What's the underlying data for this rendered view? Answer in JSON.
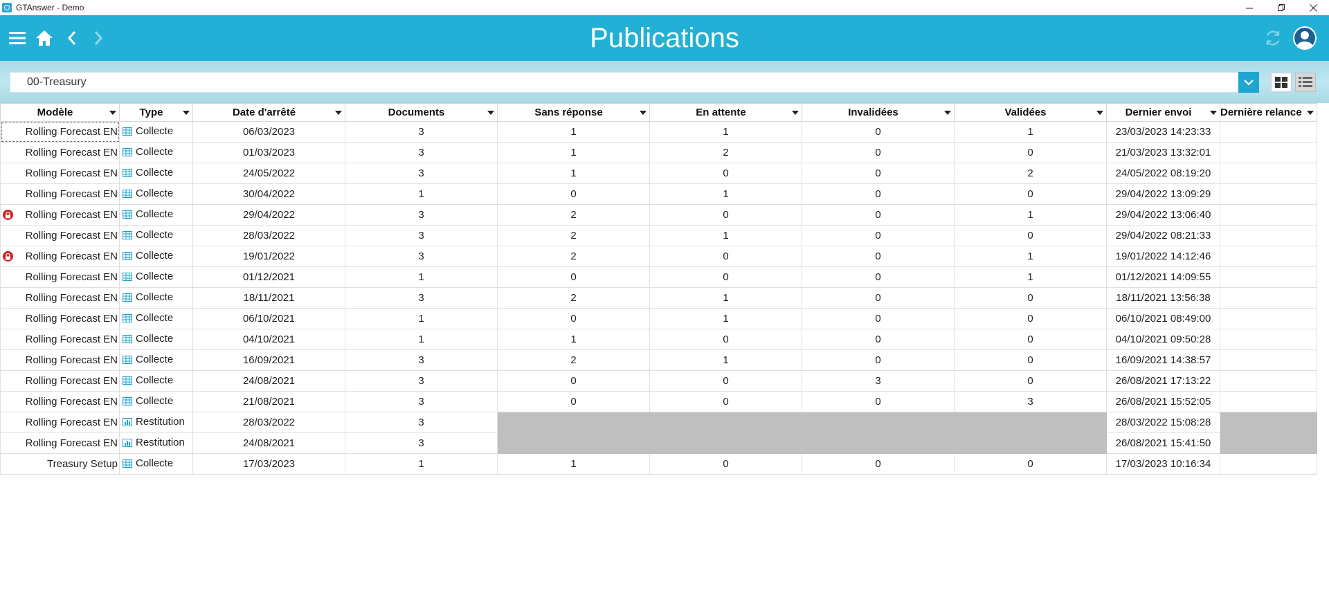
{
  "window": {
    "title": "GTAnswer - Demo"
  },
  "header": {
    "title": "Publications"
  },
  "filter": {
    "selected": "00-Treasury"
  },
  "table": {
    "columns": [
      "Modèle",
      "Type",
      "Date d'arrêté",
      "Documents",
      "Sans réponse",
      "En attente",
      "Invalidées",
      "Validées",
      "Dernier envoi",
      "Dernière relance"
    ],
    "rows": [
      {
        "modele": "Rolling Forecast EN",
        "locked": false,
        "type": "Collecte",
        "date": "06/03/2023",
        "documents": "3",
        "sans_reponse": "1",
        "en_attente": "1",
        "invalidees": "0",
        "validees": "1",
        "dernier_envoi": "23/03/2023 14:23:33",
        "derniere_relance": ""
      },
      {
        "modele": "Rolling Forecast EN",
        "locked": false,
        "type": "Collecte",
        "date": "01/03/2023",
        "documents": "3",
        "sans_reponse": "1",
        "en_attente": "2",
        "invalidees": "0",
        "validees": "0",
        "dernier_envoi": "21/03/2023 13:32:01",
        "derniere_relance": ""
      },
      {
        "modele": "Rolling Forecast EN",
        "locked": false,
        "type": "Collecte",
        "date": "24/05/2022",
        "documents": "3",
        "sans_reponse": "1",
        "en_attente": "0",
        "invalidees": "0",
        "validees": "2",
        "dernier_envoi": "24/05/2022 08:19:20",
        "derniere_relance": ""
      },
      {
        "modele": "Rolling Forecast EN",
        "locked": false,
        "type": "Collecte",
        "date": "30/04/2022",
        "documents": "1",
        "sans_reponse": "0",
        "en_attente": "1",
        "invalidees": "0",
        "validees": "0",
        "dernier_envoi": "29/04/2022 13:09:29",
        "derniere_relance": ""
      },
      {
        "modele": "Rolling Forecast EN",
        "locked": true,
        "type": "Collecte",
        "date": "29/04/2022",
        "documents": "3",
        "sans_reponse": "2",
        "en_attente": "0",
        "invalidees": "0",
        "validees": "1",
        "dernier_envoi": "29/04/2022 13:06:40",
        "derniere_relance": ""
      },
      {
        "modele": "Rolling Forecast EN",
        "locked": false,
        "type": "Collecte",
        "date": "28/03/2022",
        "documents": "3",
        "sans_reponse": "2",
        "en_attente": "1",
        "invalidees": "0",
        "validees": "0",
        "dernier_envoi": "29/04/2022 08:21:33",
        "derniere_relance": ""
      },
      {
        "modele": "Rolling Forecast EN",
        "locked": true,
        "type": "Collecte",
        "date": "19/01/2022",
        "documents": "3",
        "sans_reponse": "2",
        "en_attente": "0",
        "invalidees": "0",
        "validees": "1",
        "dernier_envoi": "19/01/2022 14:12:46",
        "derniere_relance": ""
      },
      {
        "modele": "Rolling Forecast EN",
        "locked": false,
        "type": "Collecte",
        "date": "01/12/2021",
        "documents": "1",
        "sans_reponse": "0",
        "en_attente": "0",
        "invalidees": "0",
        "validees": "1",
        "dernier_envoi": "01/12/2021 14:09:55",
        "derniere_relance": ""
      },
      {
        "modele": "Rolling Forecast EN",
        "locked": false,
        "type": "Collecte",
        "date": "18/11/2021",
        "documents": "3",
        "sans_reponse": "2",
        "en_attente": "1",
        "invalidees": "0",
        "validees": "0",
        "dernier_envoi": "18/11/2021 13:56:38",
        "derniere_relance": ""
      },
      {
        "modele": "Rolling Forecast EN",
        "locked": false,
        "type": "Collecte",
        "date": "06/10/2021",
        "documents": "1",
        "sans_reponse": "0",
        "en_attente": "1",
        "invalidees": "0",
        "validees": "0",
        "dernier_envoi": "06/10/2021 08:49:00",
        "derniere_relance": ""
      },
      {
        "modele": "Rolling Forecast EN",
        "locked": false,
        "type": "Collecte",
        "date": "04/10/2021",
        "documents": "1",
        "sans_reponse": "1",
        "en_attente": "0",
        "invalidees": "0",
        "validees": "0",
        "dernier_envoi": "04/10/2021 09:50:28",
        "derniere_relance": ""
      },
      {
        "modele": "Rolling Forecast EN",
        "locked": false,
        "type": "Collecte",
        "date": "16/09/2021",
        "documents": "3",
        "sans_reponse": "2",
        "en_attente": "1",
        "invalidees": "0",
        "validees": "0",
        "dernier_envoi": "16/09/2021 14:38:57",
        "derniere_relance": ""
      },
      {
        "modele": "Rolling Forecast EN",
        "locked": false,
        "type": "Collecte",
        "date": "24/08/2021",
        "documents": "3",
        "sans_reponse": "0",
        "en_attente": "0",
        "invalidees": "3",
        "validees": "0",
        "dernier_envoi": "26/08/2021 17:13:22",
        "derniere_relance": ""
      },
      {
        "modele": "Rolling Forecast EN",
        "locked": false,
        "type": "Collecte",
        "date": "21/08/2021",
        "documents": "3",
        "sans_reponse": "0",
        "en_attente": "0",
        "invalidees": "0",
        "validees": "3",
        "dernier_envoi": "26/08/2021 15:52:05",
        "derniere_relance": ""
      },
      {
        "modele": "Rolling Forecast EN",
        "locked": false,
        "type": "Restitution",
        "date": "28/03/2022",
        "documents": "3",
        "sans_reponse": "",
        "en_attente": "",
        "invalidees": "",
        "validees": "",
        "dernier_envoi": "28/03/2022 15:08:28",
        "derniere_relance": ""
      },
      {
        "modele": "Rolling Forecast EN",
        "locked": false,
        "type": "Restitution",
        "date": "24/08/2021",
        "documents": "3",
        "sans_reponse": "",
        "en_attente": "",
        "invalidees": "",
        "validees": "",
        "dernier_envoi": "26/08/2021 15:41:50",
        "derniere_relance": ""
      },
      {
        "modele": "Treasury Setup",
        "locked": false,
        "type": "Collecte",
        "date": "17/03/2023",
        "documents": "1",
        "sans_reponse": "1",
        "en_attente": "0",
        "invalidees": "0",
        "validees": "0",
        "dernier_envoi": "17/03/2023 10:16:34",
        "derniere_relance": ""
      }
    ]
  },
  "icons": {
    "menu": "hamburger-icon",
    "home": "home-icon",
    "back": "chevron-left-icon",
    "forward": "chevron-right-icon",
    "refresh": "refresh-icon",
    "profile": "user-avatar-icon",
    "lock": "lock-icon",
    "collecte": "table-grid-icon",
    "restitution": "bar-chart-icon"
  },
  "colors": {
    "header": "#22b0d6",
    "accent": "#1fa6d0",
    "grey_cell": "#bfbfbf",
    "lock": "#d02020"
  }
}
